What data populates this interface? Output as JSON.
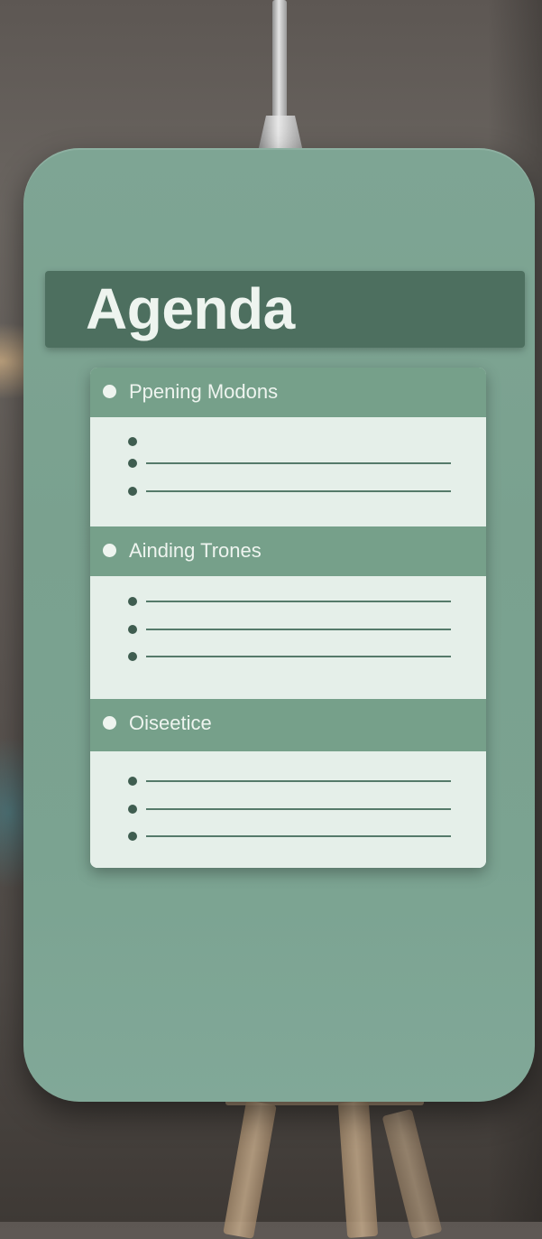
{
  "agenda": {
    "title": "Agenda",
    "sections": [
      {
        "label": "Ppening Modons",
        "item_count": 3,
        "items_with_line": [
          false,
          true,
          true
        ]
      },
      {
        "label": "Ainding Trones",
        "item_count": 3,
        "items_with_line": [
          true,
          true,
          true
        ]
      },
      {
        "label": "Oiseetice",
        "item_count": 3,
        "items_with_line": [
          true,
          true,
          true
        ]
      }
    ]
  },
  "colors": {
    "phone_body": "#7ea594",
    "header_band": "#4d6f5f",
    "section_header": "#76a08a",
    "section_body": "#e5efe9",
    "text_light": "#eef4ef",
    "bullet": "#3f5d50"
  }
}
